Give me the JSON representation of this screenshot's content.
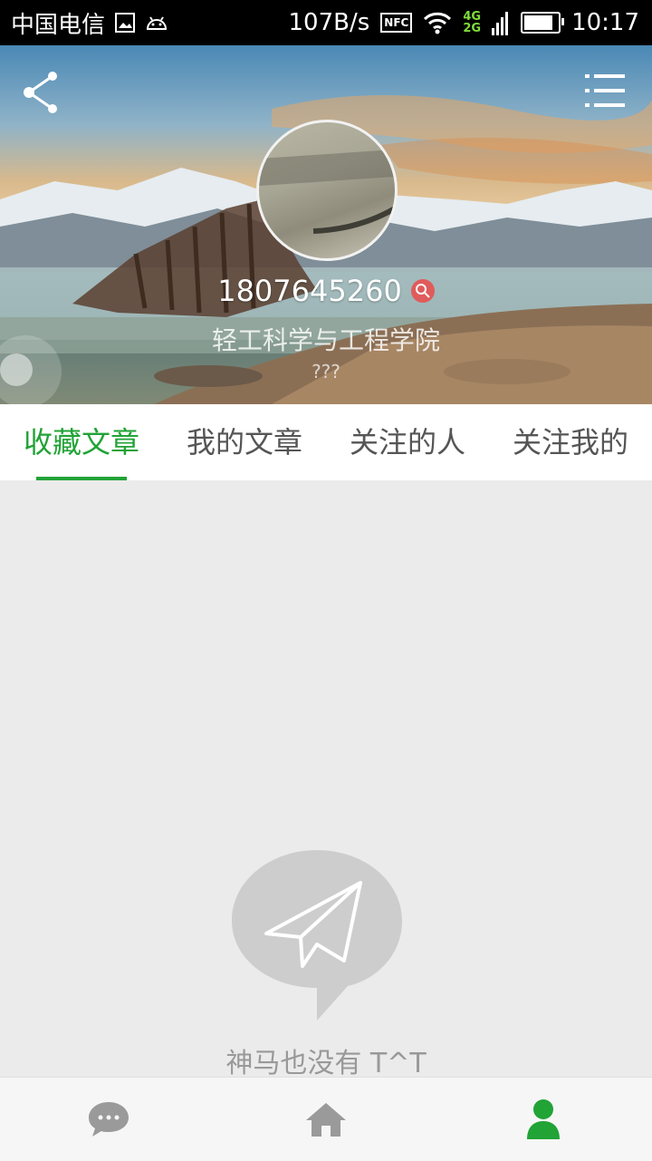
{
  "status_bar": {
    "carrier": "中国电信",
    "speed": "107B/s",
    "nfc": "NFC",
    "network_types": [
      "4G",
      "2G"
    ],
    "time": "10:17",
    "battery_level": 0.85
  },
  "profile": {
    "phone": "1807645260",
    "college": "轻工科学与工程学院",
    "extra": "???"
  },
  "tabs": [
    {
      "label": "收藏文章",
      "active": true
    },
    {
      "label": "我的文章",
      "active": false
    },
    {
      "label": "关注的人",
      "active": false
    },
    {
      "label": "关注我的",
      "active": false
    }
  ],
  "empty_state": {
    "message": "神马也没有 T^T",
    "icon": "paper-plane-bubble-icon"
  },
  "bottom_nav": [
    {
      "name": "messages",
      "icon": "chat-bubble-icon",
      "active": false
    },
    {
      "name": "home",
      "icon": "home-icon",
      "active": false
    },
    {
      "name": "profile",
      "icon": "user-icon",
      "active": true
    }
  ],
  "colors": {
    "accent": "#21a336",
    "inactive_icon": "#9a9a9a",
    "badge": "#e05b5b"
  }
}
